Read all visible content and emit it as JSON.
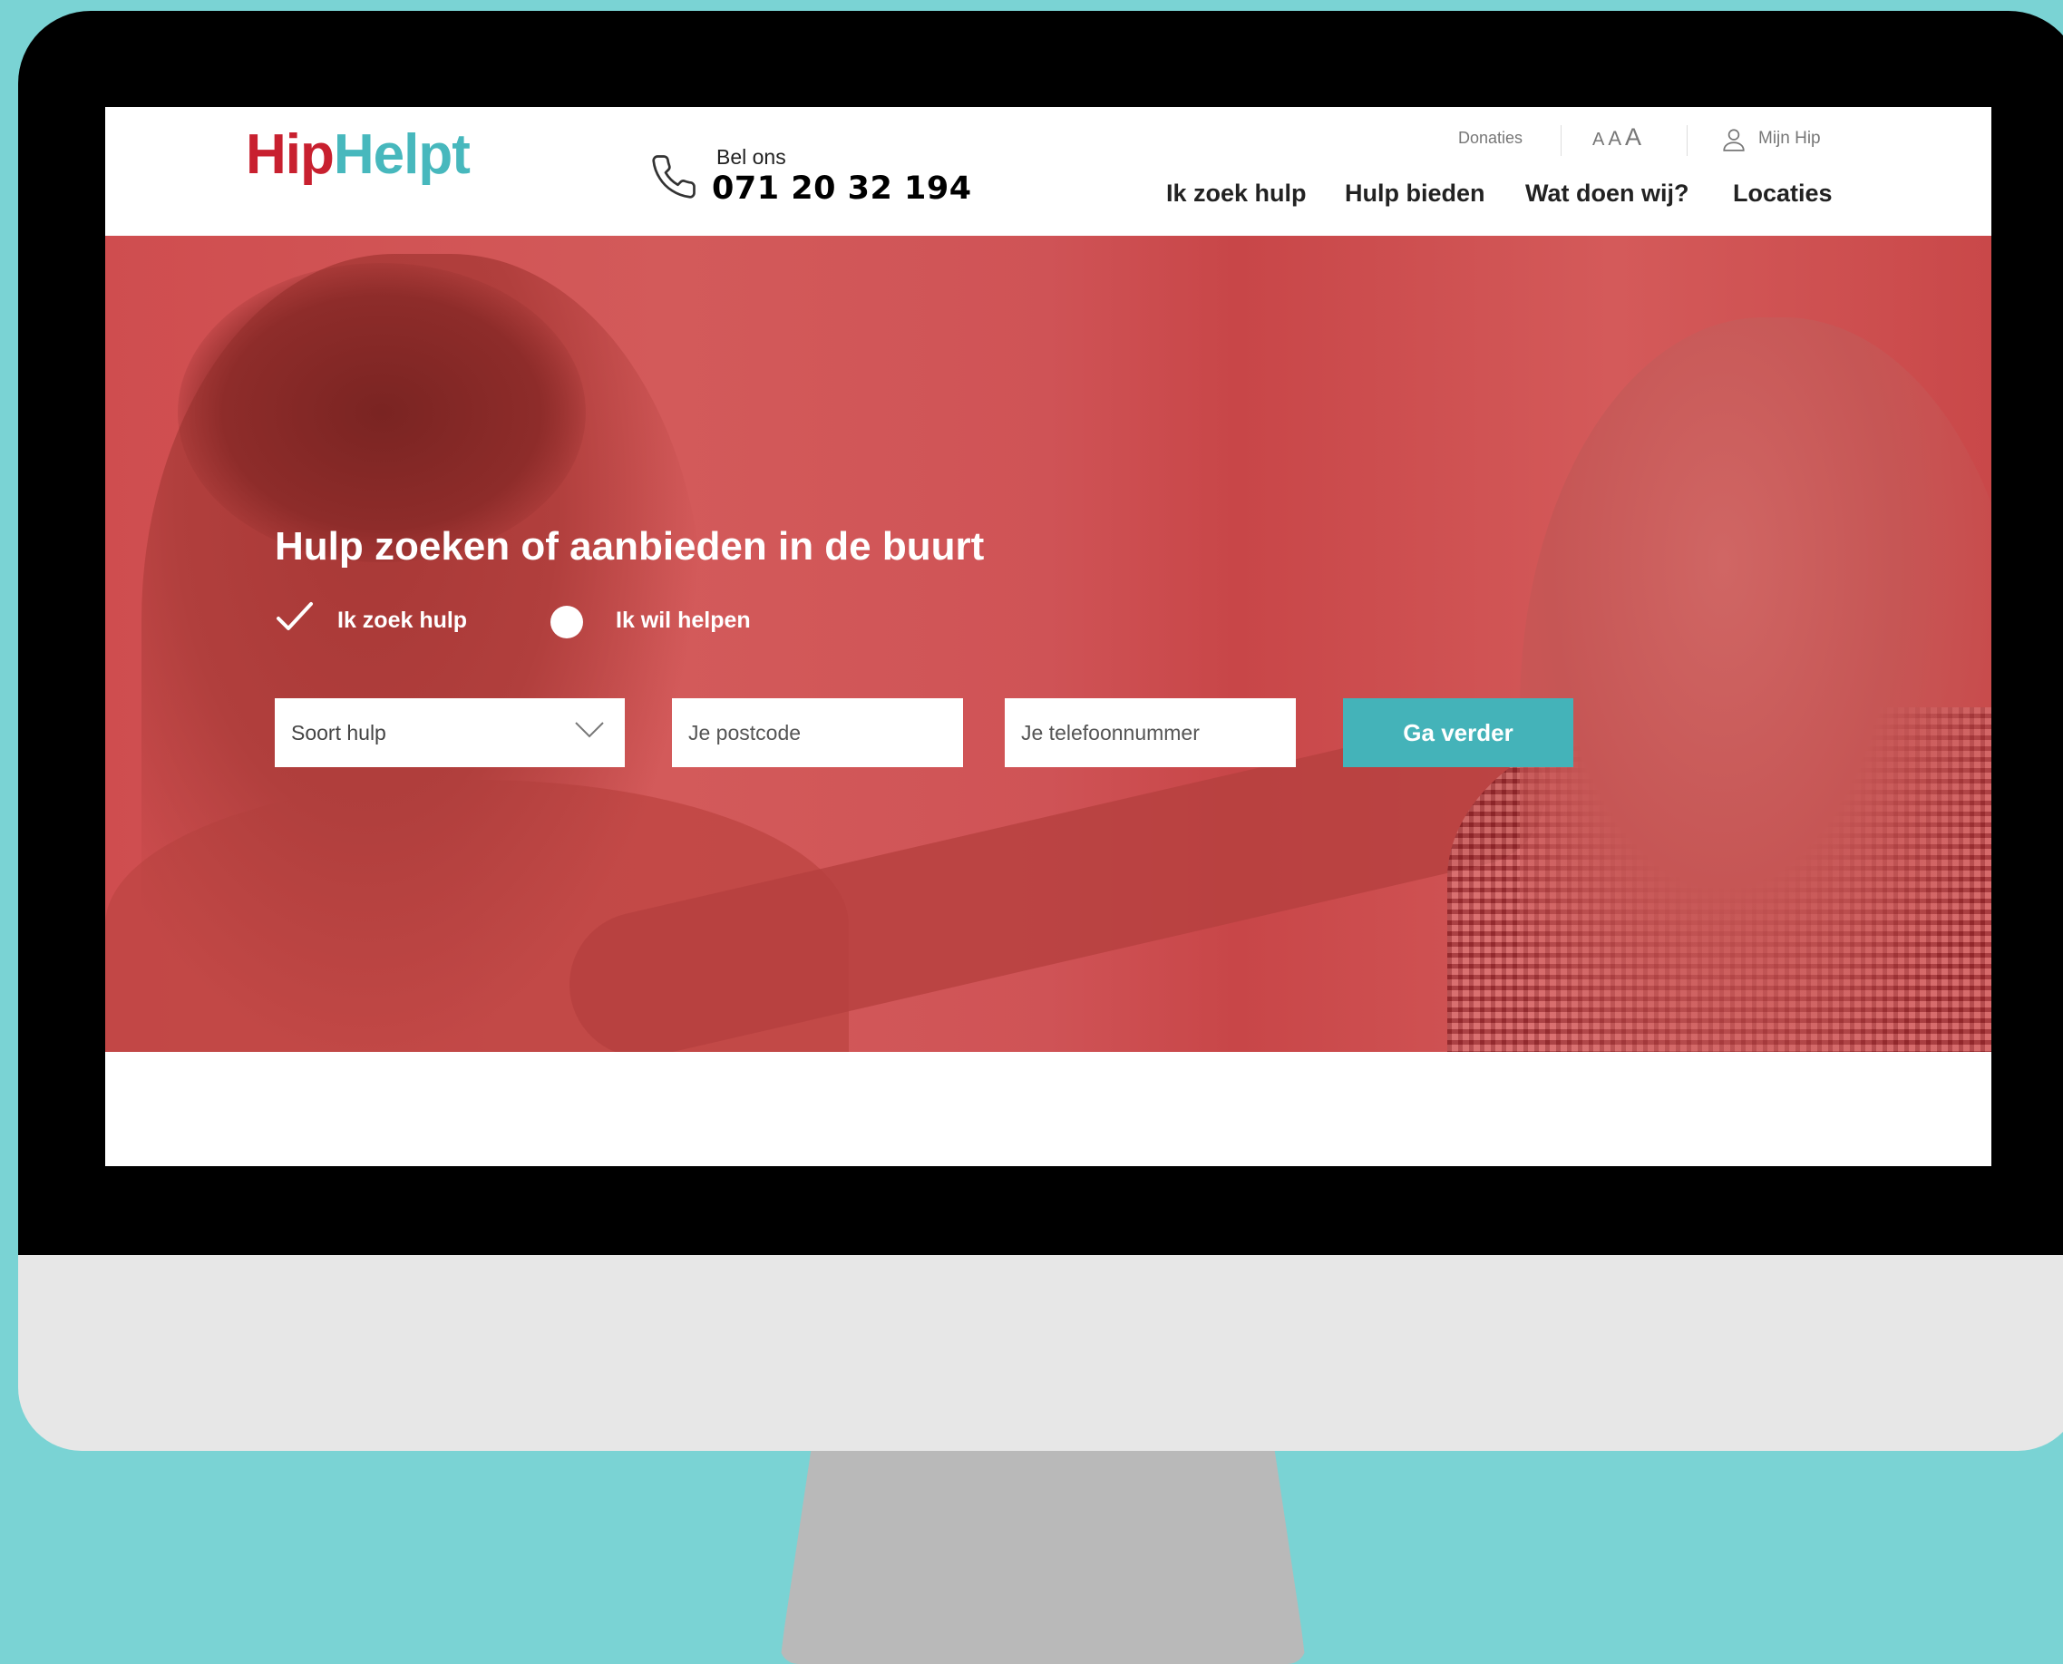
{
  "logo": {
    "part1": "Hip",
    "part2": "Helpt"
  },
  "contact": {
    "label": "Bel ons",
    "number": "071 20 32 194"
  },
  "utility": {
    "donations": "Donaties",
    "font_sizes": [
      "A",
      "A",
      "A"
    ],
    "account": "Mijn Hip"
  },
  "nav": [
    "Ik zoek hulp",
    "Hulp bieden",
    "Wat doen wij?",
    "Locaties"
  ],
  "hero": {
    "title": "Hulp zoeken of aanbieden in de buurt",
    "options": [
      {
        "label": "Ik zoek hulp",
        "selected": true
      },
      {
        "label": "Ik wil helpen",
        "selected": false
      }
    ],
    "form": {
      "type_select": "Soort hulp",
      "postcode_placeholder": "Je postcode",
      "phone_placeholder": "Je telefoonnummer",
      "submit": "Ga verder"
    }
  },
  "colors": {
    "background": "#7ad3d4",
    "brand_red": "#c8202f",
    "brand_teal": "#47b8bd",
    "button": "#44b3b9",
    "hero_overlay": "#cf4d4f"
  },
  "icons": [
    "phone-icon",
    "user-icon",
    "check-icon",
    "radio-icon",
    "chevron-down-icon"
  ]
}
